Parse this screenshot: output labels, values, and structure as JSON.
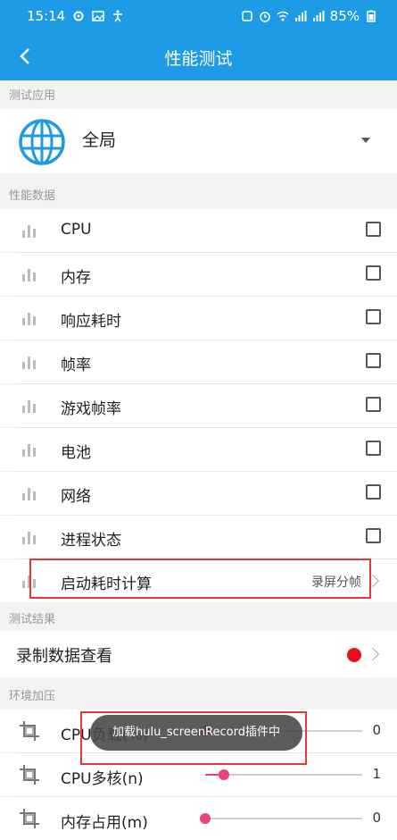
{
  "status_bar": {
    "time": "15:14",
    "battery": "85%"
  },
  "header": {
    "title": "性能测试"
  },
  "sections": {
    "app": "测试应用",
    "metrics": "性能数据",
    "results": "测试结果",
    "stress": "环境加压"
  },
  "app_selector": {
    "name": "全局"
  },
  "metrics": [
    {
      "label": "CPU",
      "checked": false
    },
    {
      "label": "内存",
      "checked": false
    },
    {
      "label": "响应耗时",
      "checked": false
    },
    {
      "label": "帧率",
      "checked": false
    },
    {
      "label": "游戏帧率",
      "checked": false
    },
    {
      "label": "电池",
      "checked": false
    },
    {
      "label": "网络",
      "checked": false
    },
    {
      "label": "进程状态",
      "checked": false
    }
  ],
  "launch_time": {
    "label": "启动耗时计算",
    "value": "录屏分帧"
  },
  "record": {
    "label": "录制数据查看",
    "indicator_color": "#e8101b"
  },
  "stress_items": [
    {
      "label": "CPU负载(%)",
      "value": "0",
      "level": 0.0
    },
    {
      "label": "CPU多核(n)",
      "value": "1",
      "level": 0.12
    },
    {
      "label": "内存占用(m)",
      "value": "0",
      "level": 0.0
    }
  ],
  "toast": {
    "text": "加载hulu_screenRecord插件中"
  },
  "colors": {
    "primary": "#1e9be7",
    "accent": "#ec407a",
    "highlight_box": "#e53935"
  }
}
